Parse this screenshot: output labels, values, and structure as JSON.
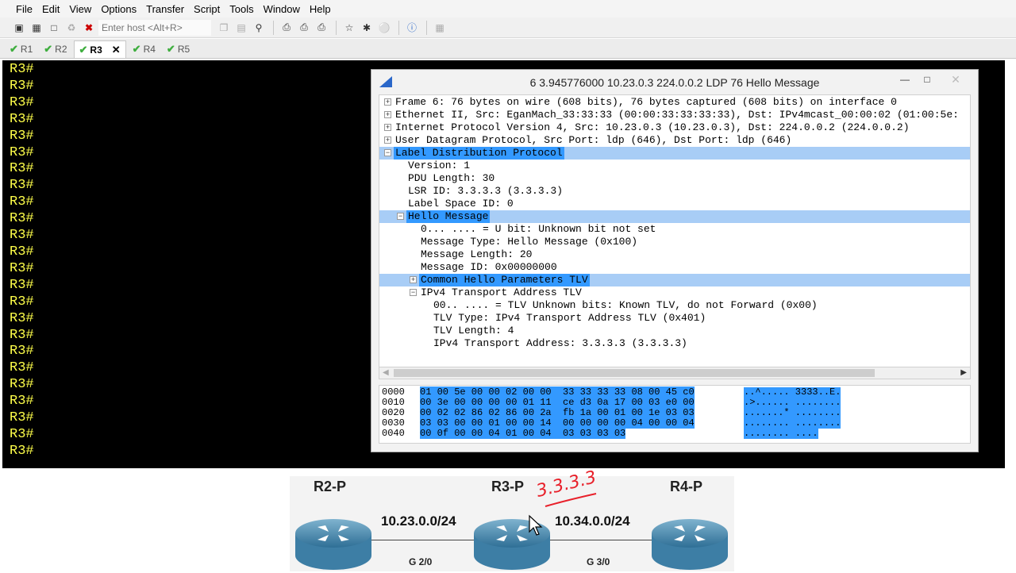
{
  "menu": [
    "File",
    "Edit",
    "View",
    "Options",
    "Transfer",
    "Script",
    "Tools",
    "Window",
    "Help"
  ],
  "toolbar": {
    "host_placeholder": "Enter host <Alt+R>"
  },
  "tabs": [
    {
      "label": "R1",
      "active": false
    },
    {
      "label": "R2",
      "active": false
    },
    {
      "label": "R3",
      "active": true
    },
    {
      "label": "R4",
      "active": false
    },
    {
      "label": "R5",
      "active": false
    }
  ],
  "terminal": {
    "prompt": "R3#",
    "line_count": 24,
    "color": "#ffff4a"
  },
  "wireshark": {
    "title": "6 3.945776000 10.23.0.3 224.0.0.2 LDP 76 Hello Message",
    "tree": [
      {
        "text": "Frame 6: 76 bytes on wire (608 bits), 76 bytes captured (608 bits) on interface 0",
        "indent": 0,
        "exp": "+",
        "hl": false
      },
      {
        "text": "Ethernet II, Src: EganMach_33:33:33 (00:00:33:33:33:33), Dst: IPv4mcast_00:00:02 (01:00:5e:",
        "indent": 0,
        "exp": "+",
        "hl": false
      },
      {
        "text": "Internet Protocol Version 4, Src: 10.23.0.3 (10.23.0.3), Dst: 224.0.0.2 (224.0.0.2)",
        "indent": 0,
        "exp": "+",
        "hl": false
      },
      {
        "text": "User Datagram Protocol, Src Port: ldp (646), Dst Port: ldp (646)",
        "indent": 0,
        "exp": "+",
        "hl": false
      },
      {
        "text": "Label Distribution Protocol",
        "indent": 0,
        "exp": "-",
        "hl": true
      },
      {
        "text": "Version: 1",
        "indent": 1,
        "exp": "",
        "hl": false
      },
      {
        "text": "PDU Length: 30",
        "indent": 1,
        "exp": "",
        "hl": false
      },
      {
        "text": "LSR ID: 3.3.3.3 (3.3.3.3)",
        "indent": 1,
        "exp": "",
        "hl": false
      },
      {
        "text": "Label Space ID: 0",
        "indent": 1,
        "exp": "",
        "hl": false
      },
      {
        "text": "Hello Message",
        "indent": 1,
        "exp": "-",
        "hl": true
      },
      {
        "text": "0... .... = U bit: Unknown bit not set",
        "indent": 2,
        "exp": "",
        "hl": false
      },
      {
        "text": "Message Type: Hello Message (0x100)",
        "indent": 2,
        "exp": "",
        "hl": false
      },
      {
        "text": "Message Length: 20",
        "indent": 2,
        "exp": "",
        "hl": false
      },
      {
        "text": "Message ID: 0x00000000",
        "indent": 2,
        "exp": "",
        "hl": false
      },
      {
        "text": "Common Hello Parameters TLV",
        "indent": 2,
        "exp": "+",
        "hl": true
      },
      {
        "text": "IPv4 Transport Address TLV",
        "indent": 2,
        "exp": "-",
        "hl": false
      },
      {
        "text": "00.. .... = TLV Unknown bits: Known TLV, do not Forward (0x00)",
        "indent": 3,
        "exp": "",
        "hl": false
      },
      {
        "text": "TLV Type: IPv4 Transport Address TLV (0x401)",
        "indent": 3,
        "exp": "",
        "hl": false
      },
      {
        "text": "TLV Length: 4",
        "indent": 3,
        "exp": "",
        "hl": false
      },
      {
        "text": "IPv4 Transport Address: 3.3.3.3 (3.3.3.3)",
        "indent": 3,
        "exp": "",
        "hl": false
      }
    ],
    "hex": [
      {
        "off": "0000",
        "bytes": "01 00 5e 00 00 02 00 00  33 33 33 33 08 00 45 c0",
        "ascii": "..^..... 3333..E."
      },
      {
        "off": "0010",
        "bytes": "00 3e 00 00 00 00 01 11  ce d3 0a 17 00 03 e0 00",
        "ascii": ".>...... ........"
      },
      {
        "off": "0020",
        "bytes": "00 02 02 86 02 86 00 2a  fb 1a 00 01 00 1e 03 03",
        "ascii": ".......* ........"
      },
      {
        "off": "0030",
        "bytes": "03 03 00 00 01 00 00 14  00 00 00 00 04 00 00 04",
        "ascii": "........ ........"
      },
      {
        "off": "0040",
        "bytes": "00 0f 00 00 04 01 00 04  03 03 03 03",
        "ascii": "........ ...."
      }
    ]
  },
  "diagram": {
    "routers": [
      "R2-P",
      "R3-P",
      "R4-P"
    ],
    "networks": [
      "10.23.0.0/24",
      "10.34.0.0/24"
    ],
    "interfaces": [
      "G 2/0",
      "G 3/0"
    ],
    "annotation": "3.3.3.3"
  }
}
